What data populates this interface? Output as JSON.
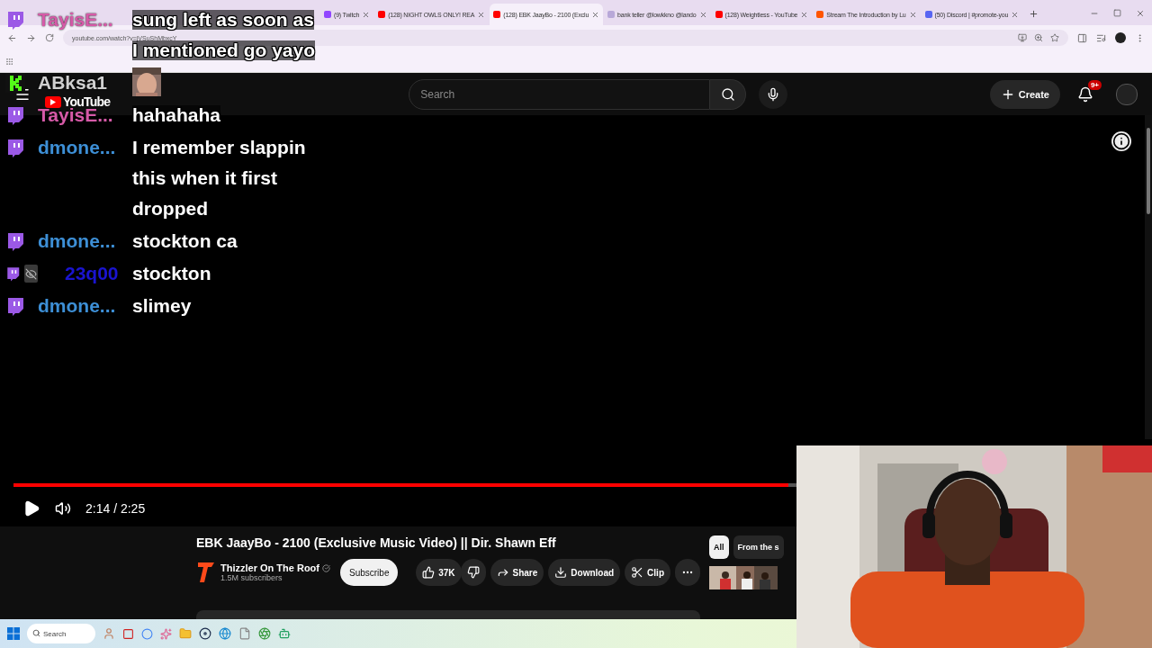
{
  "browser": {
    "tabs": [
      {
        "title": "(9) Twitch",
        "selected": false,
        "color": "#9146ff"
      },
      {
        "title": "(128) NIGHT OWLS ONLY! REA",
        "selected": false,
        "color": "#ff0000"
      },
      {
        "title": "(128) EBK JaayBo - 2100 (Exclu",
        "selected": true,
        "color": "#ff0000"
      },
      {
        "title": "bank teller @lowkkno @lando",
        "selected": false,
        "color": "#b8a8d8"
      },
      {
        "title": "(128) Weightless - YouTube",
        "selected": false,
        "color": "#ff0000"
      },
      {
        "title": "Stream The Introduction by Lu",
        "selected": false,
        "color": "#ff5500"
      },
      {
        "title": "(50) Discord | #promote-you",
        "selected": false,
        "color": "#5865f2"
      }
    ],
    "url": "youtube.com/watch?v=jVSuShMbxcY"
  },
  "youtube": {
    "logo": "YouTube",
    "search": {
      "placeholder": "Search"
    },
    "create": "Create",
    "notifications": "9+"
  },
  "chat": [
    {
      "kind": "twitch",
      "user": "TayisE...",
      "color": "#d65aa8",
      "lines": [
        "sung left as soon as",
        "I mentioned go yayo"
      ]
    },
    {
      "kind": "kick",
      "user": "ABksa1",
      "color": "#d0d0d0",
      "emote": true
    },
    {
      "kind": "twitch",
      "user": "TayisE...",
      "color": "#d65aa8",
      "lines": [
        "hahahaha"
      ]
    },
    {
      "kind": "twitch",
      "user": "dmone...",
      "color": "#3d8fd6",
      "lines": [
        "I remember slappin",
        "this when it first",
        "dropped"
      ]
    },
    {
      "kind": "twitch",
      "user": "dmone...",
      "color": "#3d8fd6",
      "lines": [
        "stockton ca"
      ]
    },
    {
      "kind": "twitch",
      "user": "23q00",
      "color": "#1a14d0",
      "hidden_badge": true,
      "lines": [
        "stockton"
      ]
    },
    {
      "kind": "twitch",
      "user": "dmone...",
      "color": "#3d8fd6",
      "lines": [
        "slimey"
      ]
    }
  ],
  "player": {
    "level": 0.99,
    "time": "2:14 / 2:25"
  },
  "video": {
    "title": "EBK JaayBo - 2100 (Exclusive Music Video) || Dir. Shawn Eff",
    "channel": "Thizzler On The Roof",
    "subscribers": "1.5M subscribers",
    "subscribe": "Subscribe",
    "likes": "37K",
    "share": "Share",
    "download": "Download",
    "clip": "Clip",
    "chips": [
      {
        "label": "All",
        "selected": true
      },
      {
        "label": "From the s",
        "selected": false
      }
    ]
  },
  "taskbar": {
    "search": {
      "placeholder": "Search"
    }
  }
}
